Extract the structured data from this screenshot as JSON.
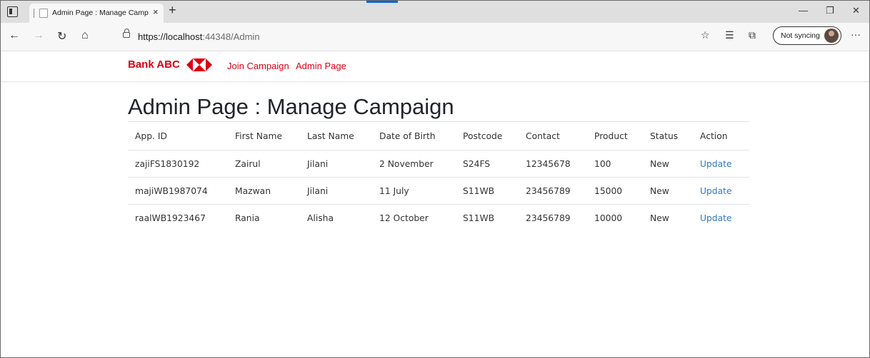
{
  "browser": {
    "tab_title": "Admin Page : Manage Campaign",
    "tab_close": "×",
    "new_tab": "+",
    "url_host": "https://localhost",
    "url_rest": ":44348/Admin",
    "sync_label": "Not syncing",
    "more": "···",
    "controls": {
      "minimize": "—",
      "restore": "❐",
      "close": "✕"
    }
  },
  "navbar": {
    "brand": "Bank ABC",
    "links": [
      "Join Campaign",
      "Admin Page"
    ],
    "brand_color": "#db0011"
  },
  "page": {
    "title": "Admin Page : Manage Campaign"
  },
  "table": {
    "columns": [
      "App. ID",
      "First Name",
      "Last Name",
      "Date of Birth",
      "Postcode",
      "Contact",
      "Product",
      "Status",
      "Action"
    ],
    "rows": [
      {
        "app_id": "zajiFS1830192",
        "first_name": "Zairul",
        "last_name": "Jilani",
        "dob": "2 November",
        "postcode": "S24FS",
        "contact": "12345678",
        "product": "100",
        "status": "New",
        "action": "Update"
      },
      {
        "app_id": "majiWB1987074",
        "first_name": "Mazwan",
        "last_name": "Jilani",
        "dob": "11 July",
        "postcode": "S11WB",
        "contact": "23456789",
        "product": "15000",
        "status": "New",
        "action": "Update"
      },
      {
        "app_id": "raalWB1923467",
        "first_name": "Rania",
        "last_name": "Alisha",
        "dob": "12 October",
        "postcode": "S11WB",
        "contact": "23456789",
        "product": "10000",
        "status": "New",
        "action": "Update"
      }
    ],
    "link_color": "#3178c6"
  }
}
